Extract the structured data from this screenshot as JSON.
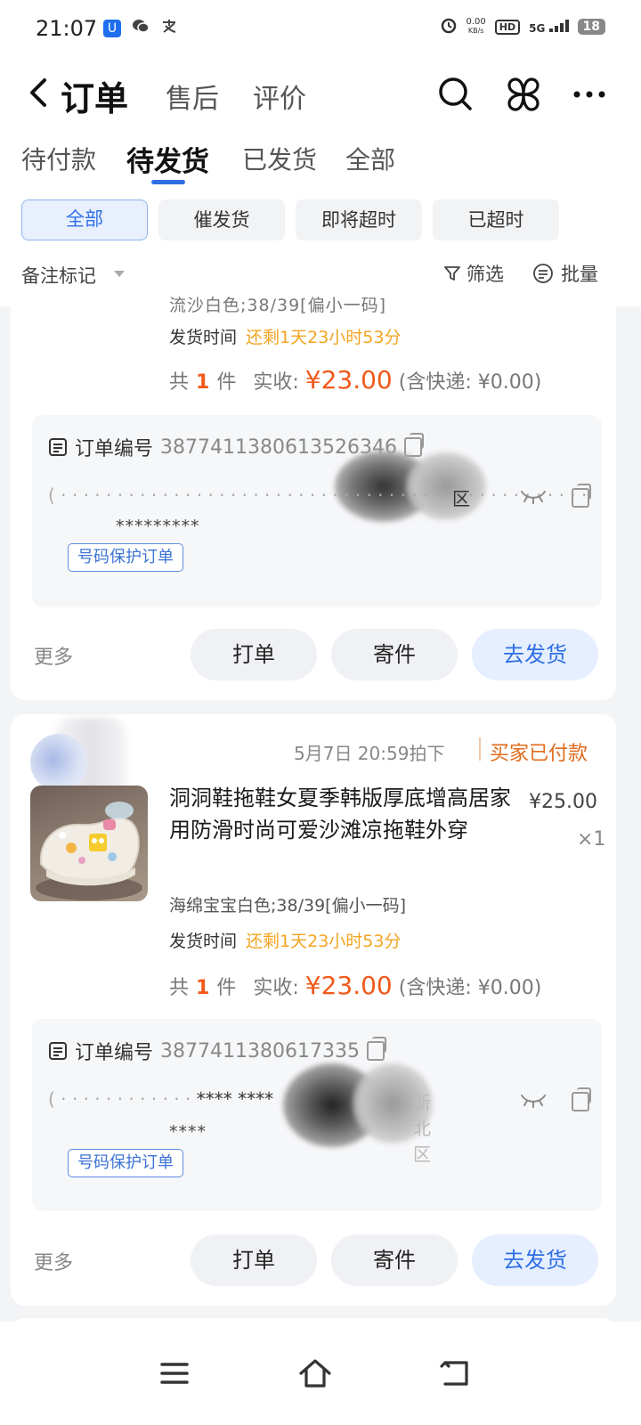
{
  "status_bar": {
    "time": "21:07",
    "net_speed_top": "0.00",
    "net_speed_unit": "KB/s",
    "hd": "HD",
    "signal": "5G",
    "battery": "18"
  },
  "header": {
    "title": "订单",
    "tab_after_sale": "售后",
    "tab_review": "评价"
  },
  "tabs": [
    {
      "label": "待付款",
      "active": false
    },
    {
      "label": "待发货",
      "active": true
    },
    {
      "label": "已发货",
      "active": false
    },
    {
      "label": "全部",
      "active": false
    }
  ],
  "chips": [
    {
      "label": "全部",
      "active": true
    },
    {
      "label": "催发货",
      "active": false
    },
    {
      "label": "即将超时",
      "active": false
    },
    {
      "label": "已超时",
      "active": false
    }
  ],
  "filter_row": {
    "remark": "备注标记",
    "filter": "筛选",
    "batch": "批量"
  },
  "orders": [
    {
      "cut_text": "流沙白色;38/39[偏小一码]",
      "ship_time_label": "发货时间",
      "ship_time_remaining": "还剩1天23小时53分",
      "total_prefix": "共",
      "total_count": "1",
      "total_unit": "件",
      "received_label": "实收:",
      "received_amount": "¥23.00",
      "shipping_note": "(含快递: ¥0.00)",
      "order_no_label": "订单编号",
      "order_no_value": "3877411380613526346",
      "address_tail": "区",
      "masked_phone": "*********",
      "protect_tag": "号码保护订单",
      "more": "更多",
      "btn_print": "打单",
      "btn_send": "寄件",
      "btn_ship": "去发货"
    },
    {
      "order_time": "5月7日 20:59拍下",
      "status": "买家已付款",
      "product_title": "洞洞鞋拖鞋女夏季韩版厚底增高居家用防滑时尚可爱沙滩凉拖鞋外穿",
      "price": "¥25.00",
      "qty": "×1",
      "sku": "海绵宝宝白色;38/39[偏小一码]",
      "ship_time_label": "发货时间",
      "ship_time_remaining": "还剩1天23小时53分",
      "total_prefix": "共",
      "total_count": "1",
      "total_unit": "件",
      "received_label": "实收:",
      "received_amount": "¥23.00",
      "shipping_note": "(含快递: ¥0.00)",
      "order_no_label": "订单编号",
      "order_no_value": "3877411380617335",
      "address_masked": "**** ****",
      "address_tail": "新北区",
      "masked_phone": "****",
      "protect_tag": "号码保护订单",
      "more": "更多",
      "btn_print": "打单",
      "btn_send": "寄件",
      "btn_ship": "去发货"
    }
  ],
  "colors": {
    "accent": "#2f6fe6",
    "price_orange": "#f05a1a",
    "timer_yellow": "#f3a420",
    "status_orange": "#e06a1a"
  }
}
